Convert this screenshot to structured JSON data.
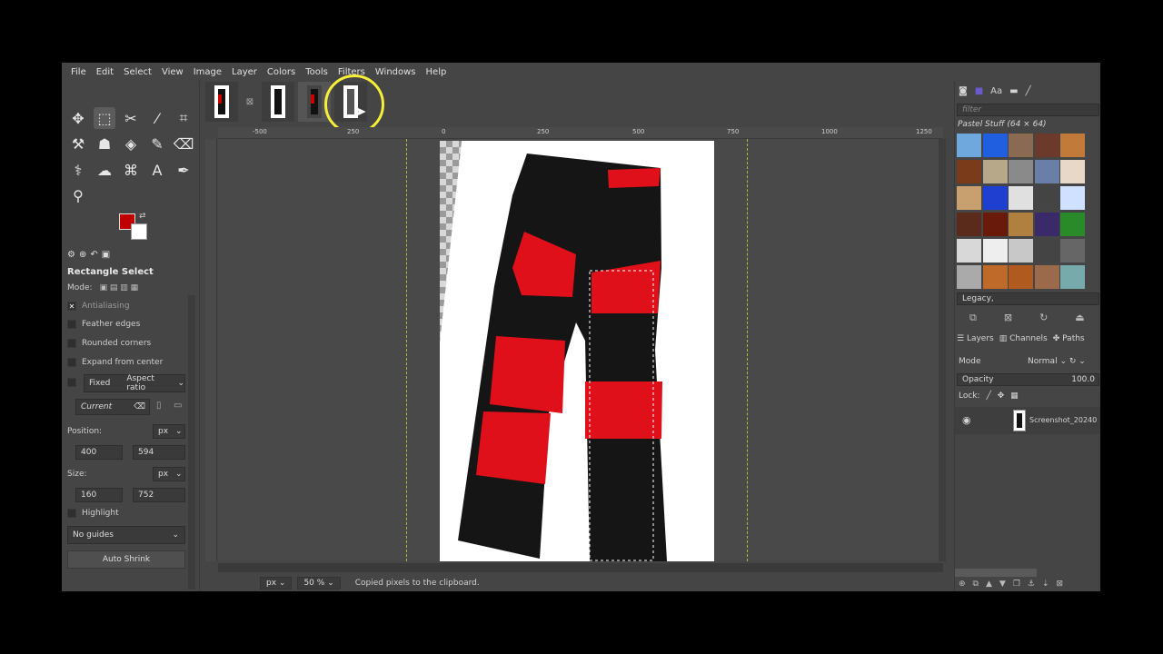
{
  "menubar": [
    "File",
    "Edit",
    "Select",
    "View",
    "Image",
    "Layer",
    "Colors",
    "Tools",
    "Filters",
    "Windows",
    "Help"
  ],
  "tool_options": {
    "title": "Rectangle Select",
    "mode_label": "Mode:",
    "antialiasing": "Antialiasing",
    "feather_edges": "Feather edges",
    "rounded_corners": "Rounded corners",
    "expand_from_center": "Expand from center",
    "fixed": "Fixed",
    "aspect_ratio": "Aspect ratio",
    "current": "Current",
    "position_label": "Position:",
    "position_unit": "px",
    "position_x": "400",
    "position_y": "594",
    "size_label": "Size:",
    "size_unit": "px",
    "size_w": "160",
    "size_h": "752",
    "highlight": "Highlight",
    "guides": "No guides",
    "auto_shrink": "Auto Shrink"
  },
  "ruler": {
    "h_labels": [
      "-500",
      "250",
      "0",
      "250",
      "500",
      "750",
      "1000",
      "1250"
    ]
  },
  "status": {
    "unit": "px",
    "zoom": "50 %",
    "message": "Copied pixels to the clipboard."
  },
  "dock": {
    "filter_placeholder": "filter",
    "pattern_name": "Pastel Stuff (64 × 64)",
    "preset": "Legacy,",
    "tabs": [
      "Layers",
      "Channels",
      "Paths"
    ],
    "mode_label": "Mode",
    "mode_value": "Normal",
    "opacity_label": "Opacity",
    "opacity_value": "100.0",
    "lock_label": "Lock:",
    "layer_name": "Screenshot_20240"
  },
  "colors": {
    "foreground": "#c00000",
    "background": "#ffffff",
    "highlight_cursor": "#f6ef3a"
  }
}
